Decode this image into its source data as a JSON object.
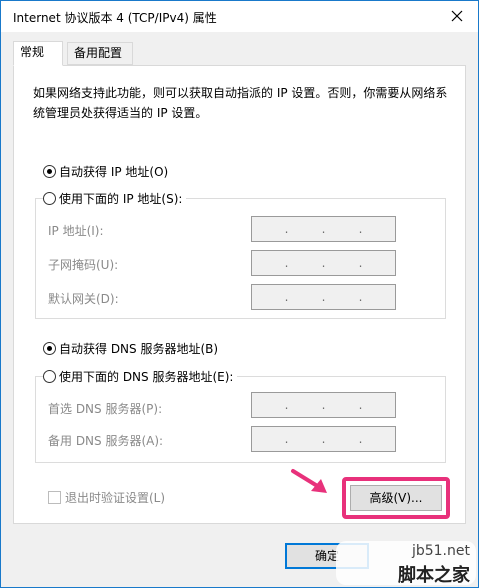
{
  "window": {
    "title": "Internet 协议版本 4 (TCP/IPv4) 属性",
    "close_icon": "close-icon"
  },
  "tabs": [
    {
      "label": "常规",
      "active": true
    },
    {
      "label": "备用配置",
      "active": false
    }
  ],
  "description": "如果网络支持此功能，则可以获取自动指派的 IP 设置。否则，你需要从网络系统管理员处获得适当的 IP 设置。",
  "ip_section": {
    "auto_label": "自动获得 IP 地址(O)",
    "auto_checked": true,
    "manual_label": "使用下面的 IP 地址(S):",
    "manual_checked": false,
    "fields": [
      {
        "label": "IP 地址(I):",
        "value": ".   .   ."
      },
      {
        "label": "子网掩码(U):",
        "value": ".   .   ."
      },
      {
        "label": "默认网关(D):",
        "value": ".   .   ."
      }
    ]
  },
  "dns_section": {
    "auto_label": "自动获得 DNS 服务器地址(B)",
    "auto_checked": true,
    "manual_label": "使用下面的 DNS 服务器地址(E):",
    "manual_checked": false,
    "fields": [
      {
        "label": "首选 DNS 服务器(P):",
        "value": ".   .   ."
      },
      {
        "label": "备用 DNS 服务器(A):",
        "value": ".   .   ."
      }
    ]
  },
  "validate_label": "退出时验证设置(L)",
  "validate_checked": false,
  "advanced_label": "高级(V)...",
  "ok_label": "确定",
  "watermark": {
    "top": "jb51.net",
    "bottom": "脚本之家"
  },
  "colors": {
    "highlight": "#e8317b",
    "accent": "#0078d7"
  }
}
